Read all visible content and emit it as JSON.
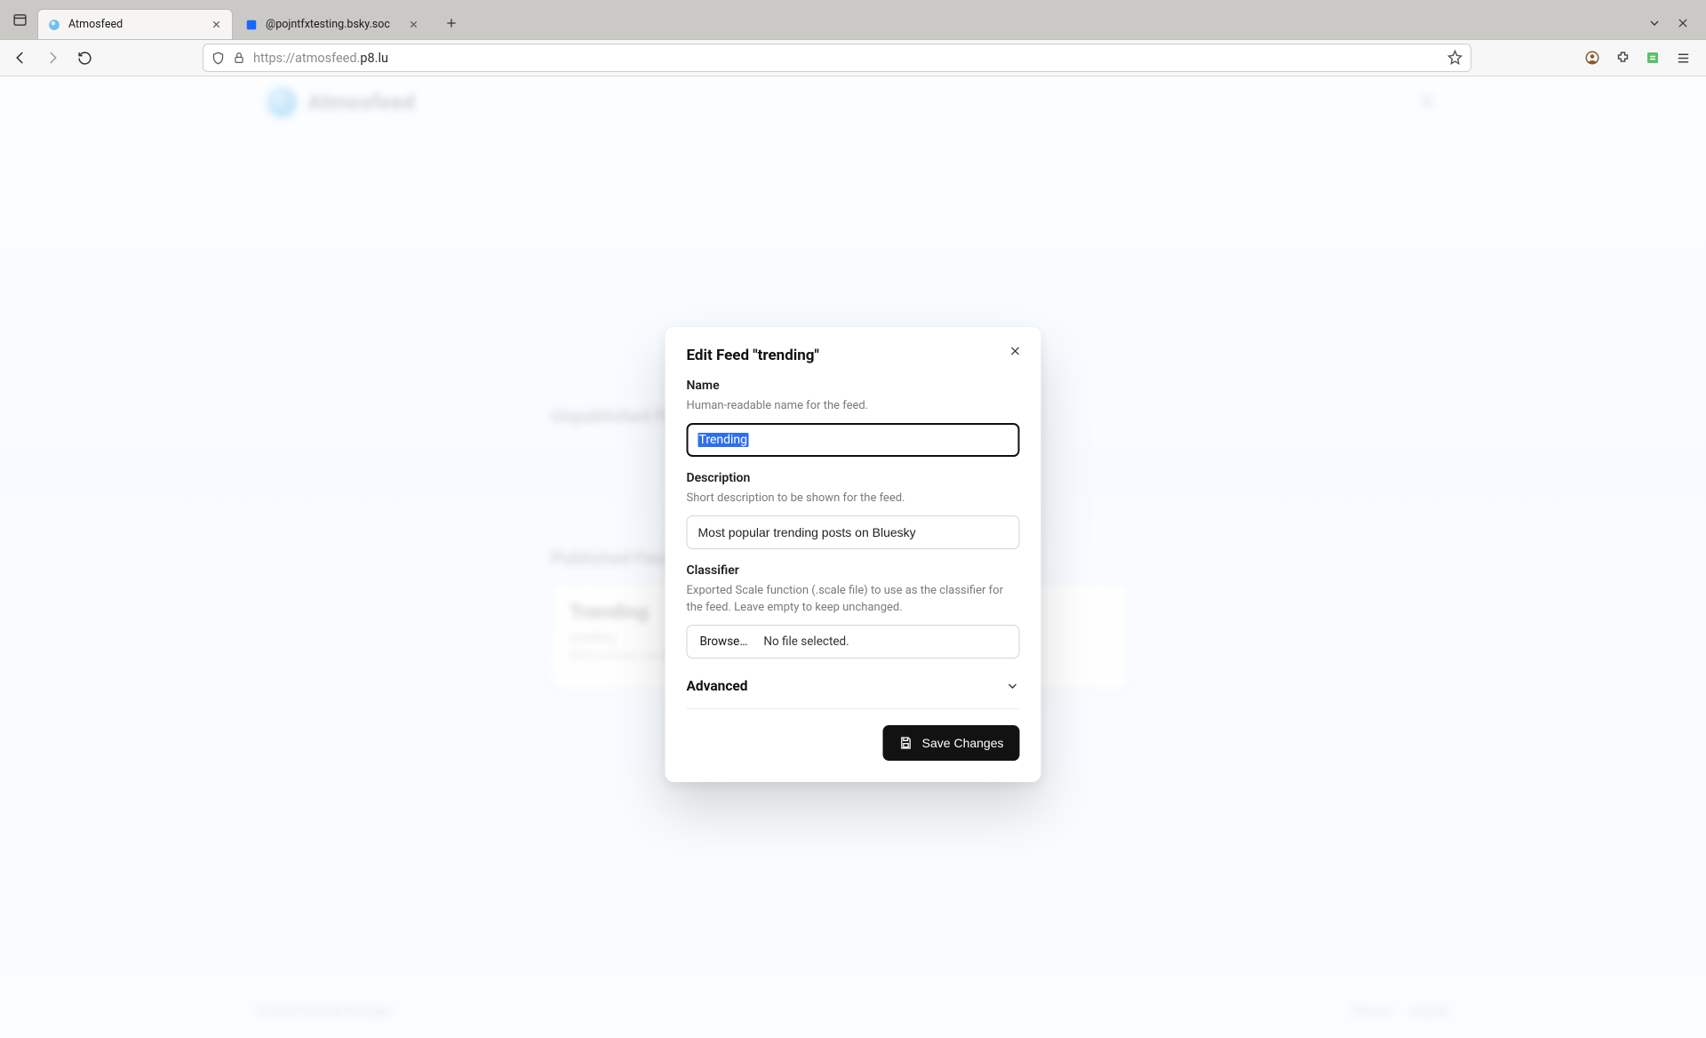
{
  "browser": {
    "tabs": [
      {
        "title": "Atmosfeed",
        "active": true
      },
      {
        "title": "@pojntfxtesting.bsky.soc",
        "active": false
      }
    ],
    "url_prefix": "https://atmosfeed.",
    "url_domain": "p8.lu",
    "url_suffix": ""
  },
  "background": {
    "brand": "Atmosfeed",
    "section1": "Unpublished Feeds",
    "section2": "Published Feeds",
    "card_title": "Trending",
    "card_sub1": "trending",
    "card_sub2": "Most popular trending posts on Bluesky",
    "footer_left": "© 2023 Felicitas Pojtinger",
    "footer_link1": "Privacy",
    "footer_link2": "Imprint"
  },
  "modal": {
    "title": "Edit Feed \"trending\"",
    "name": {
      "label": "Name",
      "help": "Human-readable name for the feed.",
      "value": "Trending"
    },
    "description": {
      "label": "Description",
      "help": "Short description to be shown for the feed.",
      "value": "Most popular trending posts on Bluesky"
    },
    "classifier": {
      "label": "Classifier",
      "help": "Exported Scale function (.scale file) to use as the classifier for the feed. Leave empty to keep unchanged.",
      "browse": "Browse…",
      "nofile": "No file selected."
    },
    "advanced_label": "Advanced",
    "save_label": "Save Changes"
  }
}
